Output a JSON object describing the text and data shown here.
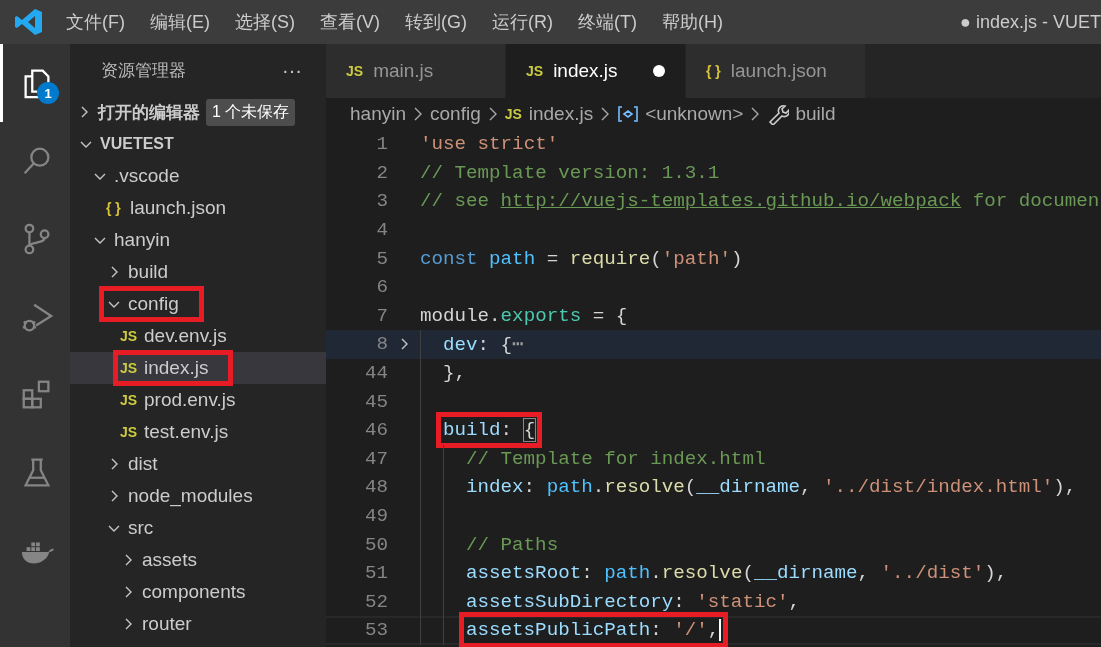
{
  "menu": {
    "items": [
      "文件(F)",
      "编辑(E)",
      "选择(S)",
      "查看(V)",
      "转到(G)",
      "运行(R)",
      "终端(T)",
      "帮助(H)"
    ],
    "title": "● index.js - VUET"
  },
  "activity_bar": [
    {
      "kind": "explorer",
      "selected": true,
      "badge": "1"
    },
    {
      "kind": "search",
      "selected": false
    },
    {
      "kind": "source-control",
      "selected": false
    },
    {
      "kind": "run-debug",
      "selected": false
    },
    {
      "kind": "extensions",
      "selected": false
    },
    {
      "kind": "testing",
      "selected": false
    },
    {
      "kind": "docker",
      "selected": false
    }
  ],
  "sidebar": {
    "title": "资源管理器",
    "actions": "···",
    "open_editors": {
      "label": "打开的编辑器",
      "badge": "1 个未保存",
      "expanded": false
    },
    "tree": [
      {
        "label": "VUETEST",
        "kind": "folder",
        "expanded": true,
        "selected": false,
        "children": [
          {
            "label": ".vscode",
            "kind": "folder",
            "expanded": true,
            "selected": false,
            "children": [
              {
                "label": "launch.json",
                "kind": "json",
                "icon_label": "{ }",
                "selected": false
              }
            ]
          },
          {
            "label": "hanyin",
            "kind": "folder",
            "expanded": true,
            "selected": false,
            "children": [
              {
                "label": "build",
                "kind": "folder",
                "expanded": false,
                "selected": false
              },
              {
                "label": "config",
                "kind": "folder",
                "expanded": true,
                "selected": false,
                "highlight": true,
                "children": [
                  {
                    "label": "dev.env.js",
                    "kind": "js",
                    "icon_label": "JS",
                    "selected": false
                  },
                  {
                    "label": "index.js",
                    "kind": "js",
                    "icon_label": "JS",
                    "selected": true,
                    "highlight": true
                  },
                  {
                    "label": "prod.env.js",
                    "kind": "js",
                    "icon_label": "JS",
                    "selected": false
                  },
                  {
                    "label": "test.env.js",
                    "kind": "js",
                    "icon_label": "JS",
                    "selected": false
                  }
                ]
              },
              {
                "label": "dist",
                "kind": "folder",
                "expanded": false,
                "selected": false
              },
              {
                "label": "node_modules",
                "kind": "folder",
                "expanded": false,
                "selected": false
              },
              {
                "label": "src",
                "kind": "folder",
                "expanded": true,
                "selected": false,
                "children": [
                  {
                    "label": "assets",
                    "kind": "folder",
                    "expanded": false,
                    "selected": false
                  },
                  {
                    "label": "components",
                    "kind": "folder",
                    "expanded": false,
                    "selected": false
                  },
                  {
                    "label": "router",
                    "kind": "folder",
                    "expanded": false,
                    "selected": false
                  }
                ]
              }
            ]
          }
        ]
      }
    ]
  },
  "tabs": [
    {
      "label": "main.js",
      "kind": "js",
      "icon_label": "JS",
      "selected": false,
      "modified": false
    },
    {
      "label": "index.js",
      "kind": "js",
      "icon_label": "JS",
      "selected": true,
      "modified": true
    },
    {
      "label": "launch.json",
      "kind": "json",
      "icon_label": "{ }",
      "selected": false,
      "modified": false
    }
  ],
  "breadcrumbs": [
    {
      "kind": "folder",
      "label": "hanyin"
    },
    {
      "kind": "folder",
      "label": "config"
    },
    {
      "kind": "js",
      "icon_label": "JS",
      "label": "index.js"
    },
    {
      "kind": "module",
      "label": "<unknown>"
    },
    {
      "kind": "method",
      "label": "build"
    }
  ],
  "code": [
    {
      "number": "1",
      "kind": "top",
      "tokens": [
        {
          "kind": "str",
          "t": "'use strict'"
        }
      ]
    },
    {
      "number": "2",
      "kind": "top",
      "tokens": [
        {
          "kind": "comment",
          "t": "// Template version: 1.3.1"
        }
      ]
    },
    {
      "number": "3",
      "kind": "top",
      "tokens": [
        {
          "kind": "comment",
          "t": "// see "
        },
        {
          "kind": "link",
          "t": "http://vuejs-templates.github.io/webpack"
        },
        {
          "kind": "comment",
          "t": " for documen"
        }
      ]
    },
    {
      "number": "4",
      "kind": "top"
    },
    {
      "number": "5",
      "kind": "top",
      "tokens": [
        {
          "kind": "kw",
          "t": "const"
        },
        {
          "kind": "var",
          "t": " path"
        },
        {
          "kind": "plain",
          "t": " = "
        },
        {
          "kind": "fn",
          "t": "require"
        },
        {
          "kind": "plain",
          "t": "("
        },
        {
          "kind": "str",
          "t": "'path'"
        },
        {
          "kind": "plain",
          "t": ")"
        }
      ]
    },
    {
      "number": "6",
      "kind": "top"
    },
    {
      "number": "7",
      "kind": "top",
      "tokens": [
        {
          "kind": "plain",
          "t": "module."
        },
        {
          "kind": "type",
          "t": "exports"
        },
        {
          "kind": "plain",
          "t": " = {"
        }
      ]
    },
    {
      "number": "8",
      "kind": "level1",
      "folded": true,
      "tokens": [
        {
          "kind": "prop",
          "t": "dev"
        },
        {
          "kind": "plain",
          "t": ": {"
        },
        {
          "kind": "fold",
          "t": "⋯"
        }
      ]
    },
    {
      "number": "44",
      "kind": "level1",
      "tokens": [
        {
          "kind": "plain",
          "t": "},"
        }
      ]
    },
    {
      "number": "45",
      "kind": "level1"
    },
    {
      "number": "46",
      "kind": "level1",
      "highlight": true,
      "tokens": [
        {
          "kind": "prop",
          "t": "build"
        },
        {
          "kind": "plain",
          "t": ": "
        },
        {
          "kind": "bracket",
          "t": "{"
        }
      ]
    },
    {
      "number": "47",
      "kind": "level2",
      "tokens": [
        {
          "kind": "comment",
          "t": "// Template for index.html"
        }
      ]
    },
    {
      "number": "48",
      "kind": "level2",
      "tokens": [
        {
          "kind": "prop",
          "t": "index"
        },
        {
          "kind": "plain",
          "t": ": "
        },
        {
          "kind": "var",
          "t": "path"
        },
        {
          "kind": "plain",
          "t": "."
        },
        {
          "kind": "fn",
          "t": "resolve"
        },
        {
          "kind": "plain",
          "t": "("
        },
        {
          "kind": "prop",
          "t": "__dirname"
        },
        {
          "kind": "plain",
          "t": ", "
        },
        {
          "kind": "str",
          "t": "'../dist/index.html'"
        },
        {
          "kind": "plain",
          "t": "),"
        }
      ]
    },
    {
      "number": "49",
      "kind": "level2"
    },
    {
      "number": "50",
      "kind": "level2",
      "tokens": [
        {
          "kind": "comment",
          "t": "// Paths"
        }
      ]
    },
    {
      "number": "51",
      "kind": "level2",
      "tokens": [
        {
          "kind": "prop",
          "t": "assetsRoot"
        },
        {
          "kind": "plain",
          "t": ": "
        },
        {
          "kind": "var",
          "t": "path"
        },
        {
          "kind": "plain",
          "t": "."
        },
        {
          "kind": "fn",
          "t": "resolve"
        },
        {
          "kind": "plain",
          "t": "("
        },
        {
          "kind": "prop",
          "t": "__dirname"
        },
        {
          "kind": "plain",
          "t": ", "
        },
        {
          "kind": "str",
          "t": "'../dist'"
        },
        {
          "kind": "plain",
          "t": "),"
        }
      ]
    },
    {
      "number": "52",
      "kind": "level2",
      "tokens": [
        {
          "kind": "prop",
          "t": "assetsSubDirectory"
        },
        {
          "kind": "plain",
          "t": ": "
        },
        {
          "kind": "str",
          "t": "'static'"
        },
        {
          "kind": "plain",
          "t": ","
        }
      ]
    },
    {
      "number": "53",
      "kind": "level2",
      "highlight": true,
      "current": true,
      "tokens": [
        {
          "kind": "prop",
          "t": "assetsPublicPath"
        },
        {
          "kind": "plain",
          "t": ": "
        },
        {
          "kind": "str",
          "t": "'/'"
        },
        {
          "kind": "plain",
          "t": ","
        }
      ]
    }
  ]
}
